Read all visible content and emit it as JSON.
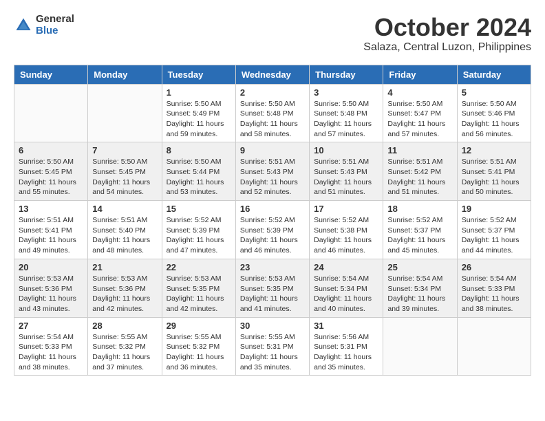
{
  "header": {
    "logo": {
      "general": "General",
      "blue": "Blue"
    },
    "month": "October 2024",
    "location": "Salaza, Central Luzon, Philippines"
  },
  "weekdays": [
    "Sunday",
    "Monday",
    "Tuesday",
    "Wednesday",
    "Thursday",
    "Friday",
    "Saturday"
  ],
  "weeks": [
    [
      {
        "day": "",
        "sunrise": "",
        "sunset": "",
        "daylight": ""
      },
      {
        "day": "",
        "sunrise": "",
        "sunset": "",
        "daylight": ""
      },
      {
        "day": "1",
        "sunrise": "Sunrise: 5:50 AM",
        "sunset": "Sunset: 5:49 PM",
        "daylight": "Daylight: 11 hours and 59 minutes."
      },
      {
        "day": "2",
        "sunrise": "Sunrise: 5:50 AM",
        "sunset": "Sunset: 5:48 PM",
        "daylight": "Daylight: 11 hours and 58 minutes."
      },
      {
        "day": "3",
        "sunrise": "Sunrise: 5:50 AM",
        "sunset": "Sunset: 5:48 PM",
        "daylight": "Daylight: 11 hours and 57 minutes."
      },
      {
        "day": "4",
        "sunrise": "Sunrise: 5:50 AM",
        "sunset": "Sunset: 5:47 PM",
        "daylight": "Daylight: 11 hours and 57 minutes."
      },
      {
        "day": "5",
        "sunrise": "Sunrise: 5:50 AM",
        "sunset": "Sunset: 5:46 PM",
        "daylight": "Daylight: 11 hours and 56 minutes."
      }
    ],
    [
      {
        "day": "6",
        "sunrise": "Sunrise: 5:50 AM",
        "sunset": "Sunset: 5:45 PM",
        "daylight": "Daylight: 11 hours and 55 minutes."
      },
      {
        "day": "7",
        "sunrise": "Sunrise: 5:50 AM",
        "sunset": "Sunset: 5:45 PM",
        "daylight": "Daylight: 11 hours and 54 minutes."
      },
      {
        "day": "8",
        "sunrise": "Sunrise: 5:50 AM",
        "sunset": "Sunset: 5:44 PM",
        "daylight": "Daylight: 11 hours and 53 minutes."
      },
      {
        "day": "9",
        "sunrise": "Sunrise: 5:51 AM",
        "sunset": "Sunset: 5:43 PM",
        "daylight": "Daylight: 11 hours and 52 minutes."
      },
      {
        "day": "10",
        "sunrise": "Sunrise: 5:51 AM",
        "sunset": "Sunset: 5:43 PM",
        "daylight": "Daylight: 11 hours and 51 minutes."
      },
      {
        "day": "11",
        "sunrise": "Sunrise: 5:51 AM",
        "sunset": "Sunset: 5:42 PM",
        "daylight": "Daylight: 11 hours and 51 minutes."
      },
      {
        "day": "12",
        "sunrise": "Sunrise: 5:51 AM",
        "sunset": "Sunset: 5:41 PM",
        "daylight": "Daylight: 11 hours and 50 minutes."
      }
    ],
    [
      {
        "day": "13",
        "sunrise": "Sunrise: 5:51 AM",
        "sunset": "Sunset: 5:41 PM",
        "daylight": "Daylight: 11 hours and 49 minutes."
      },
      {
        "day": "14",
        "sunrise": "Sunrise: 5:51 AM",
        "sunset": "Sunset: 5:40 PM",
        "daylight": "Daylight: 11 hours and 48 minutes."
      },
      {
        "day": "15",
        "sunrise": "Sunrise: 5:52 AM",
        "sunset": "Sunset: 5:39 PM",
        "daylight": "Daylight: 11 hours and 47 minutes."
      },
      {
        "day": "16",
        "sunrise": "Sunrise: 5:52 AM",
        "sunset": "Sunset: 5:39 PM",
        "daylight": "Daylight: 11 hours and 46 minutes."
      },
      {
        "day": "17",
        "sunrise": "Sunrise: 5:52 AM",
        "sunset": "Sunset: 5:38 PM",
        "daylight": "Daylight: 11 hours and 46 minutes."
      },
      {
        "day": "18",
        "sunrise": "Sunrise: 5:52 AM",
        "sunset": "Sunset: 5:37 PM",
        "daylight": "Daylight: 11 hours and 45 minutes."
      },
      {
        "day": "19",
        "sunrise": "Sunrise: 5:52 AM",
        "sunset": "Sunset: 5:37 PM",
        "daylight": "Daylight: 11 hours and 44 minutes."
      }
    ],
    [
      {
        "day": "20",
        "sunrise": "Sunrise: 5:53 AM",
        "sunset": "Sunset: 5:36 PM",
        "daylight": "Daylight: 11 hours and 43 minutes."
      },
      {
        "day": "21",
        "sunrise": "Sunrise: 5:53 AM",
        "sunset": "Sunset: 5:36 PM",
        "daylight": "Daylight: 11 hours and 42 minutes."
      },
      {
        "day": "22",
        "sunrise": "Sunrise: 5:53 AM",
        "sunset": "Sunset: 5:35 PM",
        "daylight": "Daylight: 11 hours and 42 minutes."
      },
      {
        "day": "23",
        "sunrise": "Sunrise: 5:53 AM",
        "sunset": "Sunset: 5:35 PM",
        "daylight": "Daylight: 11 hours and 41 minutes."
      },
      {
        "day": "24",
        "sunrise": "Sunrise: 5:54 AM",
        "sunset": "Sunset: 5:34 PM",
        "daylight": "Daylight: 11 hours and 40 minutes."
      },
      {
        "day": "25",
        "sunrise": "Sunrise: 5:54 AM",
        "sunset": "Sunset: 5:34 PM",
        "daylight": "Daylight: 11 hours and 39 minutes."
      },
      {
        "day": "26",
        "sunrise": "Sunrise: 5:54 AM",
        "sunset": "Sunset: 5:33 PM",
        "daylight": "Daylight: 11 hours and 38 minutes."
      }
    ],
    [
      {
        "day": "27",
        "sunrise": "Sunrise: 5:54 AM",
        "sunset": "Sunset: 5:33 PM",
        "daylight": "Daylight: 11 hours and 38 minutes."
      },
      {
        "day": "28",
        "sunrise": "Sunrise: 5:55 AM",
        "sunset": "Sunset: 5:32 PM",
        "daylight": "Daylight: 11 hours and 37 minutes."
      },
      {
        "day": "29",
        "sunrise": "Sunrise: 5:55 AM",
        "sunset": "Sunset: 5:32 PM",
        "daylight": "Daylight: 11 hours and 36 minutes."
      },
      {
        "day": "30",
        "sunrise": "Sunrise: 5:55 AM",
        "sunset": "Sunset: 5:31 PM",
        "daylight": "Daylight: 11 hours and 35 minutes."
      },
      {
        "day": "31",
        "sunrise": "Sunrise: 5:56 AM",
        "sunset": "Sunset: 5:31 PM",
        "daylight": "Daylight: 11 hours and 35 minutes."
      },
      {
        "day": "",
        "sunrise": "",
        "sunset": "",
        "daylight": ""
      },
      {
        "day": "",
        "sunrise": "",
        "sunset": "",
        "daylight": ""
      }
    ]
  ]
}
